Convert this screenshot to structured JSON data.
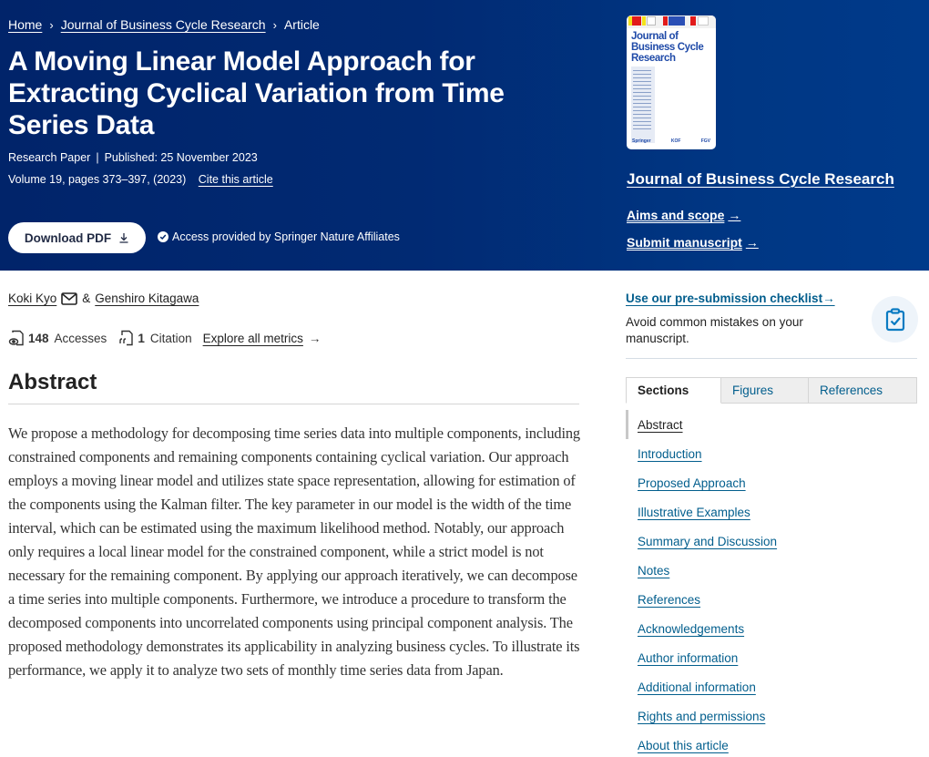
{
  "breadcrumb": {
    "items": [
      "Home",
      "Journal of Business Cycle Research",
      "Article"
    ],
    "separator": "›"
  },
  "article": {
    "title": "A Moving Linear Model Approach for Extracting Cyclical Variation from Time Series Data",
    "type": "Research Paper",
    "published": "Published: 25 November 2023",
    "volume": "Volume 19, pages 373–397, (2023)",
    "cite_label": "Cite this article",
    "download_label": "Download PDF",
    "access_text": "Access provided by Springer Nature Affiliates"
  },
  "journal": {
    "cover_title_lines": [
      "Journal of",
      "Business Cycle",
      "Research"
    ],
    "cover_publishers": [
      "Springer",
      "KOF",
      "FGV"
    ],
    "name": "Journal of Business Cycle Research",
    "aims_label": "Aims and scope",
    "submit_label": "Submit manuscript",
    "arrow": "→"
  },
  "authors": {
    "first": "Koki Kyo",
    "joiner": "&",
    "second": "Genshiro Kitagawa"
  },
  "metrics": {
    "accesses_count": "148",
    "accesses_label": "Accesses",
    "citations_count": "1",
    "citations_label": "Citation",
    "explore_label": "Explore all metrics",
    "arrow": "→"
  },
  "abstract": {
    "heading": "Abstract",
    "text": "We propose a methodology for decomposing time series data into multiple components, including constrained components and remaining components containing cyclical variation. Our approach employs a moving linear model and utilizes state space representation, allowing for estimation of the components using the Kalman filter. The key parameter in our model is the width of the time interval, which can be estimated using the maximum likelihood method. Notably, our approach only requires a local linear model for the constrained component, while a strict model is not necessary for the remaining component. By applying our approach iteratively, we can decompose a time series into multiple components. Furthermore, we introduce a procedure to transform the decomposed components into uncorrelated components using principal component analysis. The proposed methodology demonstrates its applicability in analyzing business cycles. To illustrate its performance, we apply it to analyze two sets of monthly time series data from Japan."
  },
  "sidebar": {
    "checklist_label": "Use our pre-submission checklist",
    "checklist_arrow": "→",
    "checklist_desc": "Avoid common mistakes on your manuscript.",
    "tabs": [
      {
        "label": "Sections",
        "active": true
      },
      {
        "label": "Figures",
        "active": false
      },
      {
        "label": "References",
        "active": false
      }
    ],
    "sections": [
      "Abstract",
      "Introduction",
      "Proposed Approach",
      "Illustrative Examples",
      "Summary and Discussion",
      "Notes",
      "References",
      "Acknowledgements",
      "Author information",
      "Additional information",
      "Rights and permissions",
      "About this article"
    ],
    "current_section": "Abstract"
  },
  "colors": {
    "header_bg": "#01246a",
    "link_blue": "#025e8d",
    "text": "#222222"
  }
}
